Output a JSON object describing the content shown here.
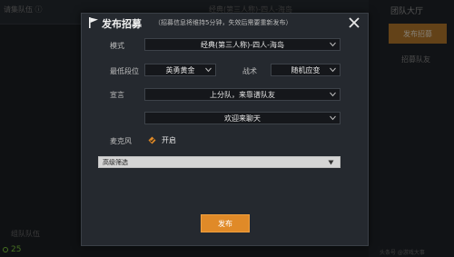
{
  "background": {
    "top_left_text": "请集队伍 ⓘ",
    "top_mid_text": "经典(第三人称)-四人-海岛",
    "right_title": "团队大厅",
    "right_button": "发布招募",
    "right_link": "招募队友",
    "bottom_left_text": "组队队伍",
    "fps_value": "25",
    "watermark": "头条号 @游戏大事"
  },
  "dialog": {
    "title": "发布招募",
    "hint": "（招募信息将维持5分钟，失效后需要重新发布）",
    "mode_label": "模式",
    "mode_value": "经典(第三人称)-四人-海岛",
    "rank_label": "最低段位",
    "rank_value": "英勇黄金",
    "tactic_label": "战术",
    "tactic_value": "随机应变",
    "slogan_label": "宣言",
    "slogan_value_1": "上分队，来靠谱队友",
    "slogan_value_2": "欢迎来聊天",
    "mic_label": "麦克风",
    "mic_status": "开启",
    "advanced_filter": "高级筛选",
    "publish_button": "发布"
  },
  "colors": {
    "accent": "#e08a28",
    "panel": "#25292f",
    "field": "#15171b"
  }
}
